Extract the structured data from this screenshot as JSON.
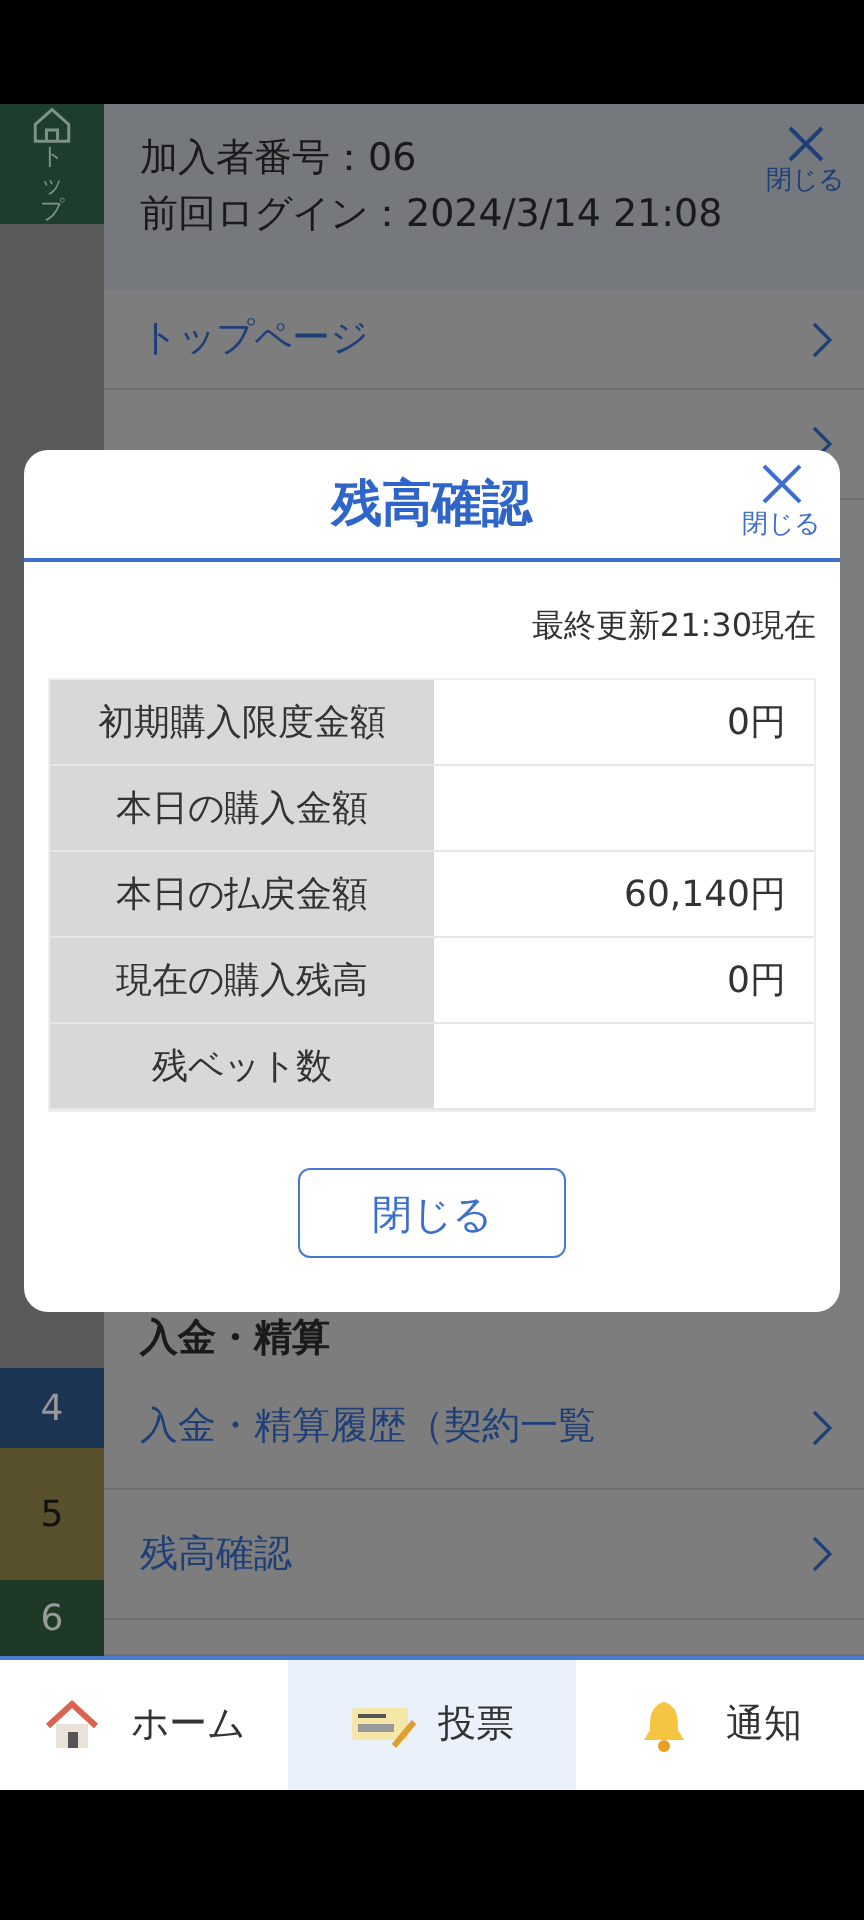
{
  "sidebar": {
    "top_tab": {
      "label": "トップ",
      "selected": true
    },
    "strips": [
      {
        "label": "4",
        "color": "#1c3553"
      },
      {
        "label": "5",
        "color": "#57502a"
      },
      {
        "label": "6",
        "color": "#1e3a26"
      }
    ]
  },
  "menu": {
    "member_number": "加入者番号：06",
    "last_login": "前回ログイン：2024/3/14 21:08",
    "close_label": "閉じる",
    "items": [
      {
        "kind": "link",
        "label": "トップページ"
      },
      {
        "kind": "link"
      },
      {
        "kind": "spacer"
      },
      {
        "kind": "section",
        "label": "入金・精算"
      },
      {
        "kind": "link",
        "label": "入金・精算履歴（契約一覧"
      },
      {
        "kind": "link",
        "label": "残高確認"
      },
      {
        "kind": "link"
      }
    ]
  },
  "dialog": {
    "title": "残高確認",
    "close_label": "閉じる",
    "updated": "最終更新21:30現在",
    "rows": [
      {
        "label": "初期購入限度金額",
        "value": "0円"
      },
      {
        "label": "本日の購入金額"
      },
      {
        "label": "本日の払戻金額",
        "value": "60,140円"
      },
      {
        "label": "現在の購入残高",
        "value": "0円"
      },
      {
        "label": "残ベット数"
      }
    ],
    "button": "閉じる"
  },
  "bottom_nav": [
    {
      "label": "ホーム",
      "selected": false
    },
    {
      "label": "投票",
      "selected": true
    },
    {
      "label": "通知",
      "selected": false
    }
  ]
}
